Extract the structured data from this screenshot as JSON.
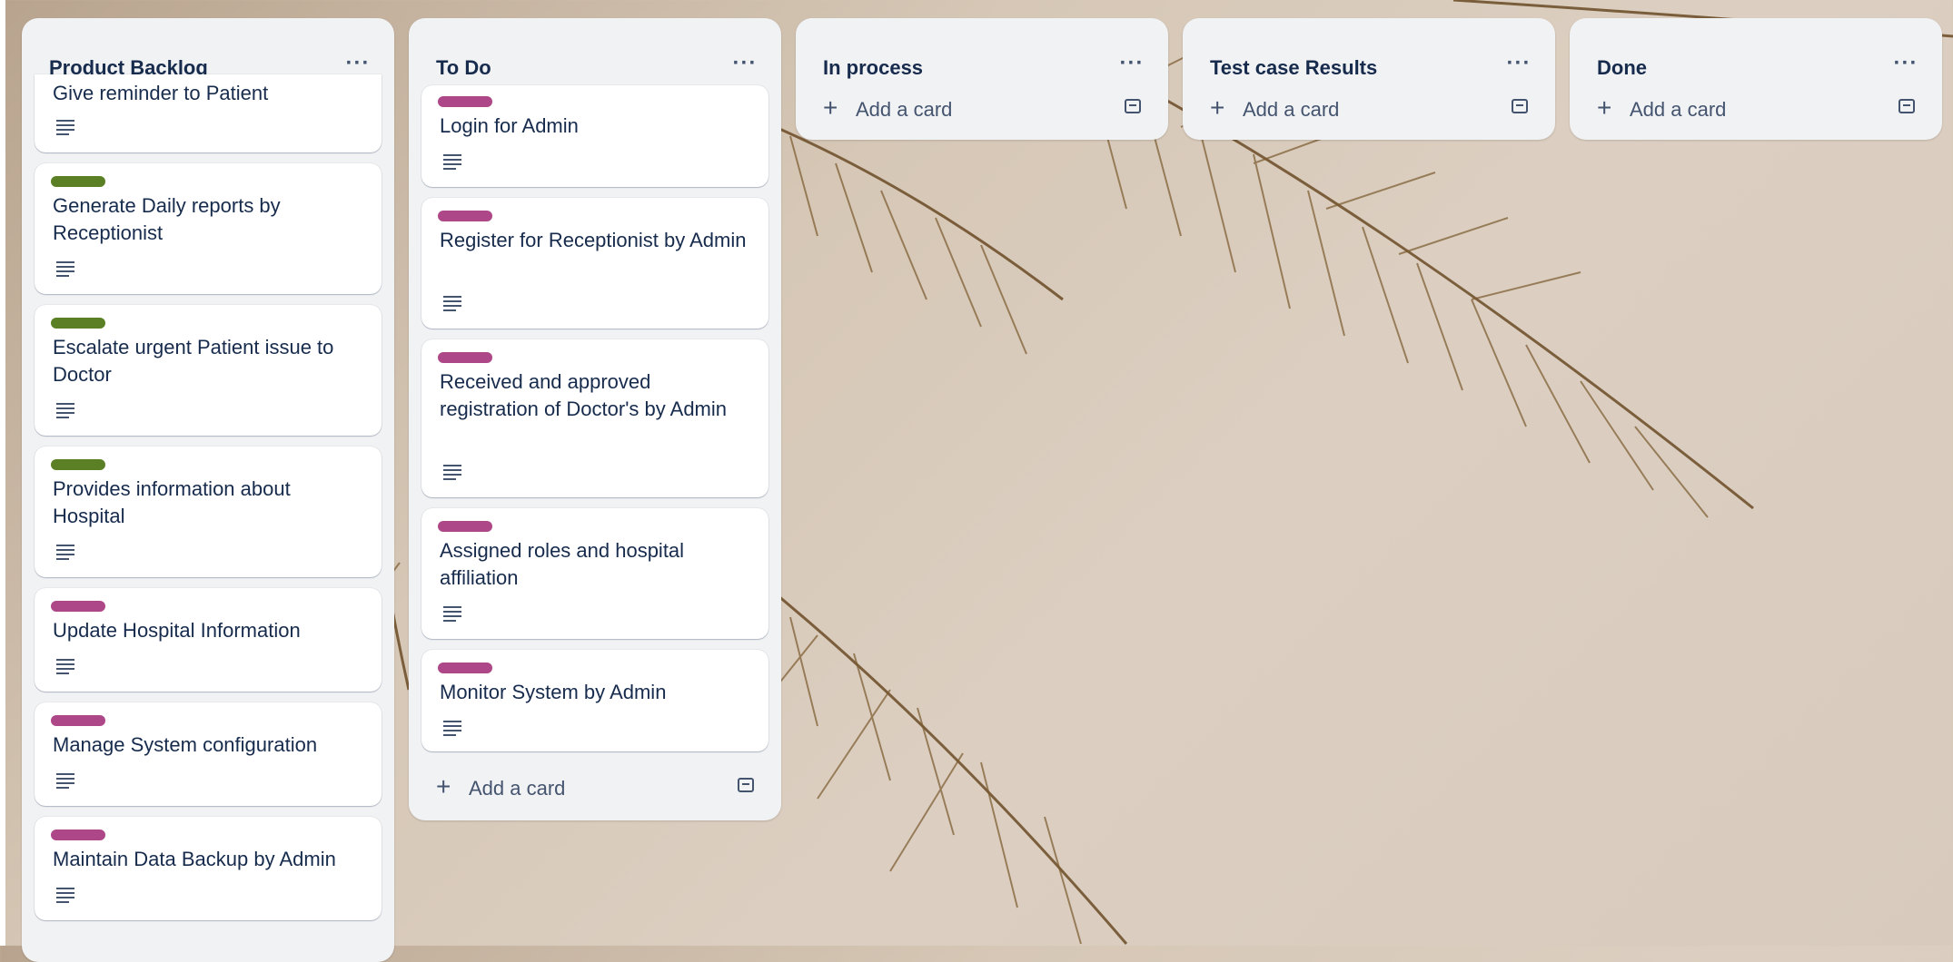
{
  "colors": {
    "list_bg": "#f1f2f4",
    "green_label": "#5b7f24",
    "pink_label": "#ae4787",
    "text": "#172b4d",
    "muted": "#44546f"
  },
  "lists": [
    {
      "title": "Product Backlog",
      "menu_icon": "ellipsis-icon",
      "cards": [
        {
          "title": "Give reminder to Patient",
          "label_color": ""
        },
        {
          "title": "Generate Daily reports by Receptionist",
          "label_color": "green"
        },
        {
          "title": "Escalate urgent Patient issue to Doctor",
          "label_color": "green"
        },
        {
          "title": "Provides information about Hospital",
          "label_color": "green"
        },
        {
          "title": "Update Hospital Information",
          "label_color": "pink"
        },
        {
          "title": "Manage System configuration",
          "label_color": "pink"
        },
        {
          "title": "Maintain Data Backup by Admin",
          "label_color": "pink"
        }
      ]
    },
    {
      "title": "To Do",
      "menu_icon": "ellipsis-icon",
      "cards": [
        {
          "title": "Login for Admin",
          "label_color": "pink"
        },
        {
          "title": "Register for Receptionist by Admin",
          "label_color": "pink"
        },
        {
          "title": "Received and approved registration of Doctor's by Admin",
          "label_color": "pink"
        },
        {
          "title": "Assigned roles and hospital affiliation",
          "label_color": "pink"
        },
        {
          "title": "Monitor System by Admin",
          "label_color": "pink"
        }
      ],
      "add_card": "Add a card"
    },
    {
      "title": "In process",
      "menu_icon": "ellipsis-icon",
      "add_card": "Add a card"
    },
    {
      "title": "Test case Results",
      "menu_icon": "ellipsis-icon",
      "add_card": "Add a card"
    },
    {
      "title": "Done",
      "menu_icon": "ellipsis-icon",
      "add_card": "Add a card"
    }
  ]
}
